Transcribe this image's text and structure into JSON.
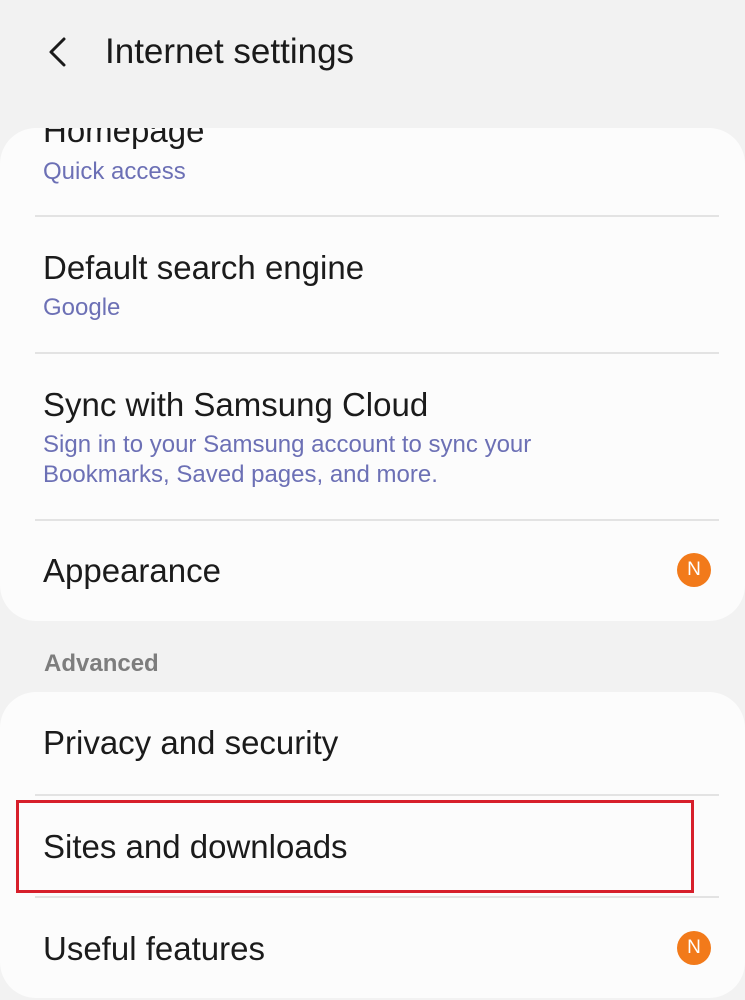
{
  "header": {
    "title": "Internet settings",
    "back_icon": "chevron-left-icon"
  },
  "general": {
    "items": [
      {
        "title": "Homepage",
        "subtitle": "Quick access"
      },
      {
        "title": "Default search engine",
        "subtitle": "Google"
      },
      {
        "title": "Sync with Samsung Cloud",
        "subtitle_line1": "Sign in to your Samsung account to sync your",
        "subtitle_line2": "Bookmarks, Saved pages, and more."
      },
      {
        "title": "Appearance",
        "badge": "N"
      }
    ]
  },
  "advanced": {
    "label": "Advanced",
    "items": [
      {
        "title": "Privacy and security"
      },
      {
        "title": "Sites and downloads",
        "highlighted": true
      },
      {
        "title": "Useful features",
        "badge": "N"
      }
    ]
  },
  "colors": {
    "background": "#f2f2f2",
    "card": "#fcfcfc",
    "subtitle": "#6c70b5",
    "badge": "#f27a1a",
    "highlight_border": "#d71f2b"
  }
}
